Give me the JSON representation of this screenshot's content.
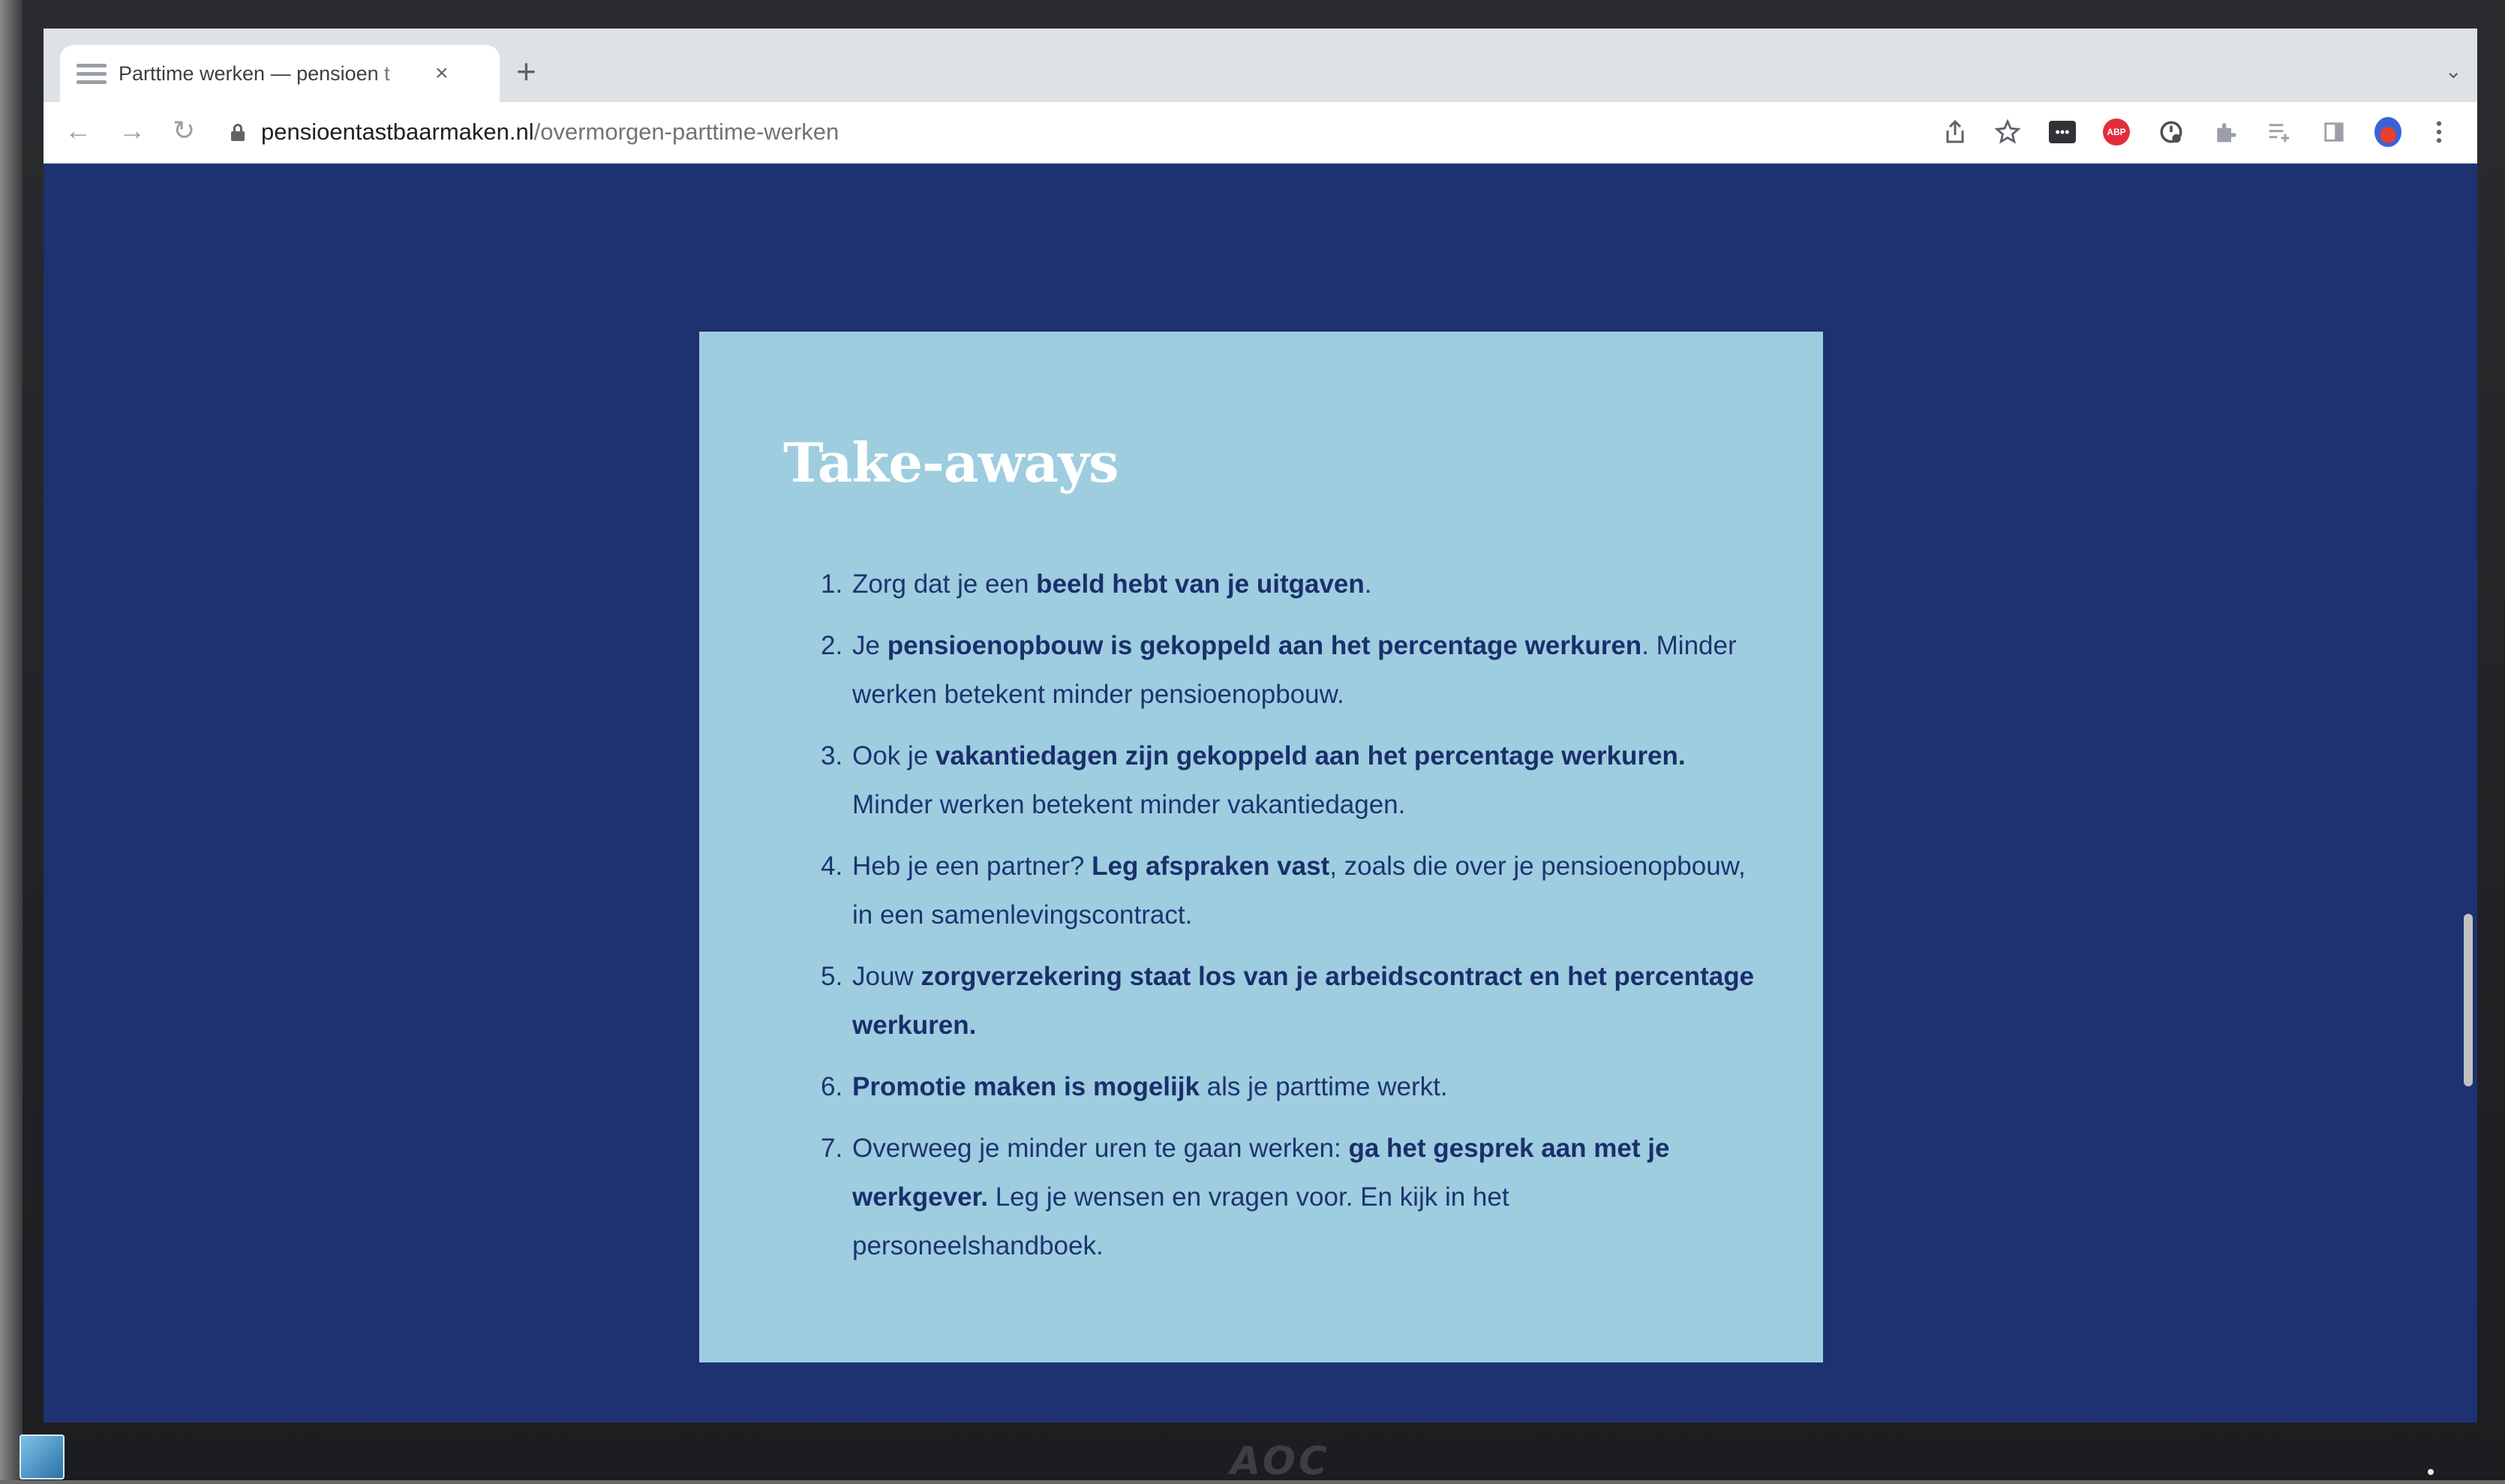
{
  "browser": {
    "tab": {
      "title": "Parttime werken — pensioen t",
      "close_glyph": "×"
    },
    "new_tab_glyph": "+",
    "tab_menu_glyph": "⌄",
    "nav": {
      "back_glyph": "←",
      "forward_glyph": "→",
      "reload_glyph": "↻"
    },
    "address": {
      "host": "pensioentastbaarmaken.nl",
      "path": "/overmorgen-parttime-werken"
    },
    "toolbar_icons": {
      "share": "share-icon",
      "bookmark": "star-icon",
      "ext1_label": "•••",
      "adblock_label": "ABP",
      "profile": "avatar"
    }
  },
  "card": {
    "title": "Take-aways",
    "items": [
      {
        "num": "1.",
        "pre": "Zorg dat je een ",
        "bold": "beeld hebt van je uitgaven",
        "post": "."
      },
      {
        "num": "2.",
        "pre": "Je ",
        "bold": "pensioenopbouw is gekoppeld aan het percentage werkuren",
        "post": ". Minder werken betekent minder pensioenopbouw."
      },
      {
        "num": "3.",
        "pre": "Ook je ",
        "bold": "vakantiedagen zijn gekoppeld aan het percentage werkuren.",
        "post": " Minder werken betekent minder vakantiedagen."
      },
      {
        "num": "4.",
        "pre": "Heb je een partner? ",
        "bold": "Leg afspraken vast",
        "post": ", zoals die over je pensioenopbouw, in een samenlevingscontract."
      },
      {
        "num": "5.",
        "pre": "Jouw ",
        "bold": "zorgverzekering staat los van je arbeidscontract en het percentage werkuren.",
        "post": ""
      },
      {
        "num": "6.",
        "pre": "",
        "bold": "Promotie maken is mogelijk",
        "post": " als je parttime werkt."
      },
      {
        "num": "7.",
        "pre": "Overweeg je minder uren te gaan werken: ",
        "bold": "ga het gesprek aan met je werkgever.",
        "post": " Leg je wensen en vragen voor. En kijk in het personeelshandboek."
      }
    ]
  },
  "monitor": {
    "brand": "AOC"
  },
  "colors": {
    "page_background": "#1e3170",
    "card_background": "#9ecde0",
    "text_navy": "#1d3470"
  }
}
